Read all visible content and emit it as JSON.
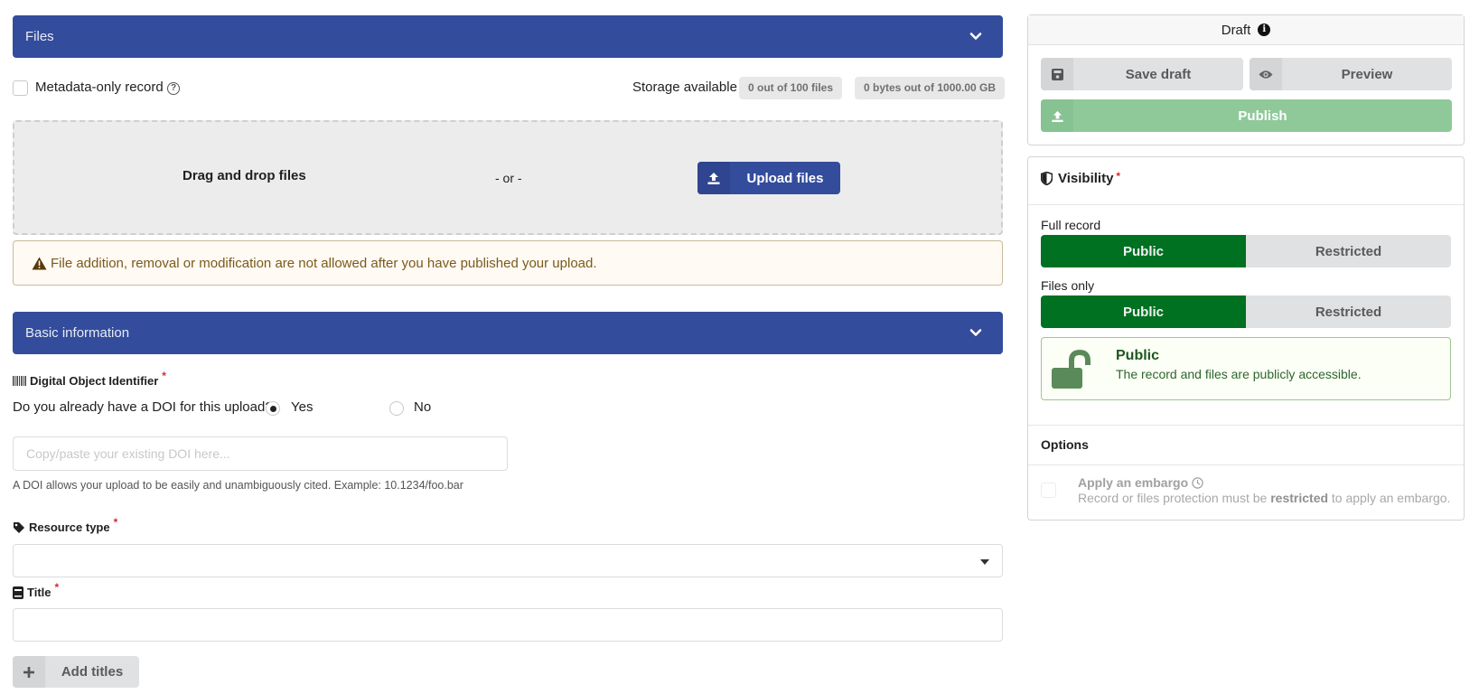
{
  "files_section": {
    "header": "Files",
    "metadata_only_label": "Metadata-only record",
    "storage_label": "Storage available",
    "files_quota": "0 out of 100 files",
    "size_quota": "0 bytes out of 1000.00 GB",
    "drag_drop": "Drag and drop files",
    "or": "- or -",
    "upload_button": "Upload files",
    "warning": "File addition, removal or modification are not allowed after you have published your upload."
  },
  "basic_info": {
    "header": "Basic information",
    "doi": {
      "label": "Digital Object Identifier",
      "required_mark": "*",
      "question": "Do you already have a DOI for this upload?",
      "options": [
        {
          "label": "Yes",
          "selected": true
        },
        {
          "label": "No",
          "selected": false
        }
      ],
      "placeholder": "Copy/paste your existing DOI here...",
      "value": "",
      "help": "A DOI allows your upload to be easily and unambiguously cited. Example: 10.1234/foo.bar"
    },
    "resource_type": {
      "label": "Resource type",
      "required_mark": "*",
      "value": ""
    },
    "title": {
      "label": "Title",
      "required_mark": "*",
      "value": ""
    },
    "add_titles_button": "Add titles"
  },
  "sidebar": {
    "status": "Draft",
    "save_draft": "Save draft",
    "preview": "Preview",
    "publish": "Publish",
    "visibility": {
      "title": "Visibility",
      "required_mark": "*",
      "full_record_label": "Full record",
      "files_only_label": "Files only",
      "full_record": {
        "public": "Public",
        "restricted": "Restricted",
        "selected": "Public"
      },
      "files_only": {
        "public": "Public",
        "restricted": "Restricted",
        "selected": "Public"
      },
      "summary_title": "Public",
      "summary_text": "The record and files are publicly accessible."
    },
    "options": {
      "title": "Options",
      "embargo_label": "Apply an embargo",
      "embargo_help_pre": "Record or files protection must be ",
      "embargo_help_bold": "restricted",
      "embargo_help_post": " to apply an embargo."
    }
  },
  "colors": {
    "primary": "#344c9c",
    "public_green": "#007121",
    "publish_disabled": "#8fc99a",
    "warning_bg": "#fffaf3"
  }
}
